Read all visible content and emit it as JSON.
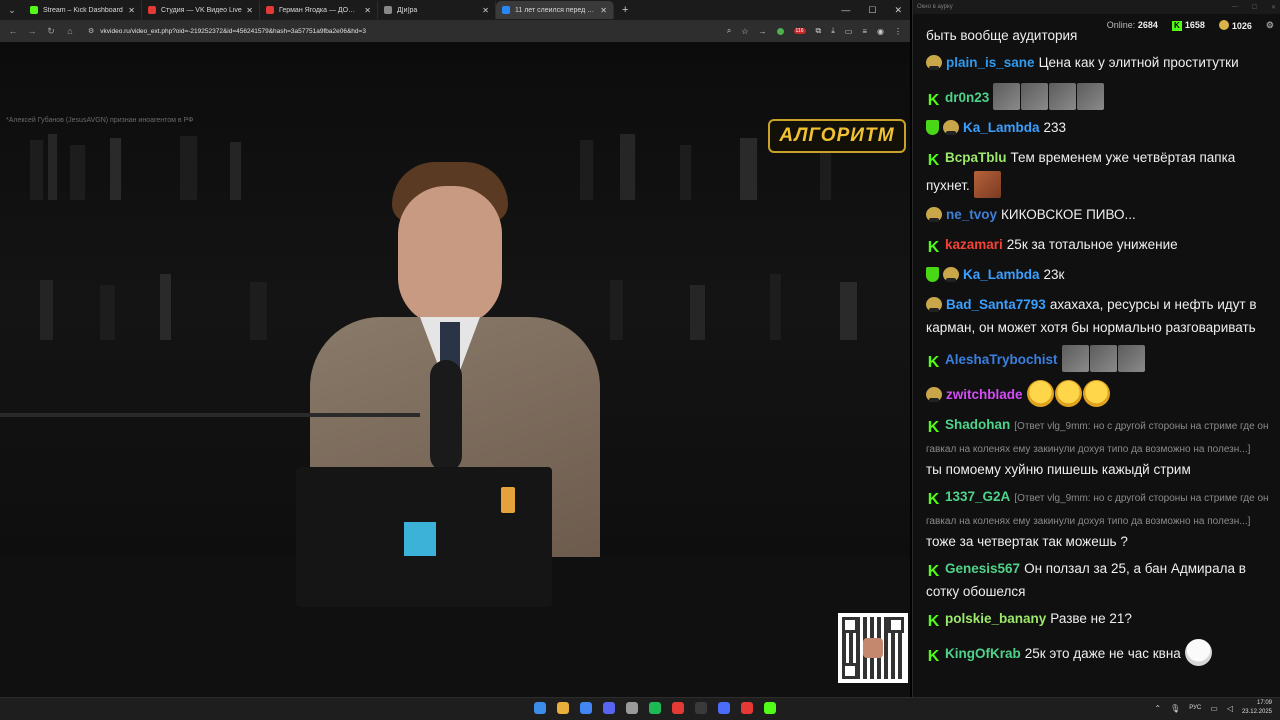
{
  "browser": {
    "tabs": [
      {
        "title": "Stream – Kick Dashboard",
        "color": "#53fc18",
        "active": false
      },
      {
        "title": "Студия — VK Видео Live",
        "color": "#e53935",
        "active": false
      },
      {
        "title": "Герман Ягодка — ДОМ 2 и ан",
        "color": "#e53935",
        "active": false
      },
      {
        "title": "Д[и]ра",
        "color": "#888888",
        "active": false
      },
      {
        "title": "11 лет слеился перед Укр",
        "color": "#2787f5",
        "active": true
      }
    ],
    "new_tab": "+",
    "url": "vkvideo.ru/video_ext.php?oid=-219252372&id=456241579&hash=3a57751a9fba2e06&hd=3",
    "ext_badge": "116"
  },
  "video": {
    "disclaimer": "*Алексей Губанов (JesusAVGN) признан иноагентом в РФ",
    "logo_text": "АЛГОРИТМ"
  },
  "chat": {
    "window_title": "Окно в аурку",
    "online_label": "Online:",
    "online_count": "2684",
    "kick_count": "1658",
    "other_count": "1026",
    "top_fragment": "быть вообще аудитория",
    "messages": [
      {
        "badges": [
          "face"
        ],
        "user": "plain_is_sane",
        "color": "#2e9bf0",
        "text": "Цена как у элитной проститутки",
        "emotes": []
      },
      {
        "badges": [
          "kick"
        ],
        "user": "dr0n23",
        "color": "#4fd28a",
        "text": "",
        "emotes": [
          "gray",
          "gray",
          "gray",
          "gray"
        ]
      },
      {
        "badges": [
          "shield",
          "face"
        ],
        "user": "Ka_Lambda",
        "color": "#3aa0ff",
        "text": "233",
        "emotes": []
      },
      {
        "badges": [
          "kick"
        ],
        "user": "BcpaTblu",
        "color": "#9be86b",
        "text": "Тем временем уже четвёртая папка пухнет.",
        "emotes": [
          "skin"
        ]
      },
      {
        "badges": [
          "face"
        ],
        "user": "ne_tvoy",
        "color": "#3f7fd8",
        "text": "КИКОВСКОЕ ПИВО...",
        "emotes": []
      },
      {
        "badges": [
          "kick"
        ],
        "user": "kazamari",
        "color": "#f44336",
        "text": "25к за тотальное унижение",
        "emotes": []
      },
      {
        "badges": [
          "shield",
          "face"
        ],
        "user": "Ka_Lambda",
        "color": "#3aa0ff",
        "text": "23к",
        "emotes": []
      },
      {
        "badges": [
          "face"
        ],
        "user": "Bad_Santa7793",
        "color": "#3aa0ff",
        "text": "ахахаха, ресурсы и нефть идут в карман, он может хотя бы нормально разговаривать",
        "emotes": []
      },
      {
        "badges": [
          "kick"
        ],
        "user": "AleshaTrybochist",
        "color": "#3a7fe0",
        "text": "",
        "emotes": [
          "gray",
          "gray",
          "gray"
        ]
      },
      {
        "badges": [
          "face"
        ],
        "user": "zwitchblade",
        "color": "#d34cf5",
        "text": "",
        "emotes": [
          "laugh",
          "laugh",
          "laugh"
        ]
      },
      {
        "badges": [
          "kick"
        ],
        "user": "Shadohan",
        "color": "#4fd28a",
        "reply": "[Ответ vlg_9mm: но с другой стороны на стриме где он гавкал на коленях ему закинули дохуя типо да возможно на полезн...]",
        "text": "ты помоему хуйню пишешь кажыдй стрим",
        "emotes": []
      },
      {
        "badges": [
          "kick"
        ],
        "user": "1337_G2A",
        "color": "#4fd28a",
        "reply": "[Ответ vlg_9mm: но с другой стороны на стриме где он гавкал на коленях ему закинули дохуя типо да возможно на полезн...]",
        "text": "тоже за четвертак так можешь ?",
        "emotes": []
      },
      {
        "badges": [
          "kick"
        ],
        "user": "Genesis567",
        "color": "#4fd28a",
        "text": "Он ползал за 25, а бан Адмирала в сотку обошелся",
        "emotes": []
      },
      {
        "badges": [
          "kick"
        ],
        "user": "polskie_banany",
        "color": "#9be86b",
        "text": "Разве не 21?",
        "emotes": []
      },
      {
        "badges": [
          "kick"
        ],
        "user": "KingOfKrab",
        "color": "#4fd28a",
        "text": "25к это даже не час квна",
        "emotes": [
          "joker"
        ]
      }
    ]
  },
  "taskbar": {
    "lang": "РУС",
    "time": "17:09",
    "date": "23.12.2025",
    "apps": [
      "#3b8ee8",
      "#e8b03b",
      "#4285f4",
      "#5865f2",
      "#9a9a9a",
      "#1db954",
      "#e53935",
      "#3a3a3a",
      "#4a6cf7",
      "#e53935",
      "#53fc18"
    ]
  }
}
